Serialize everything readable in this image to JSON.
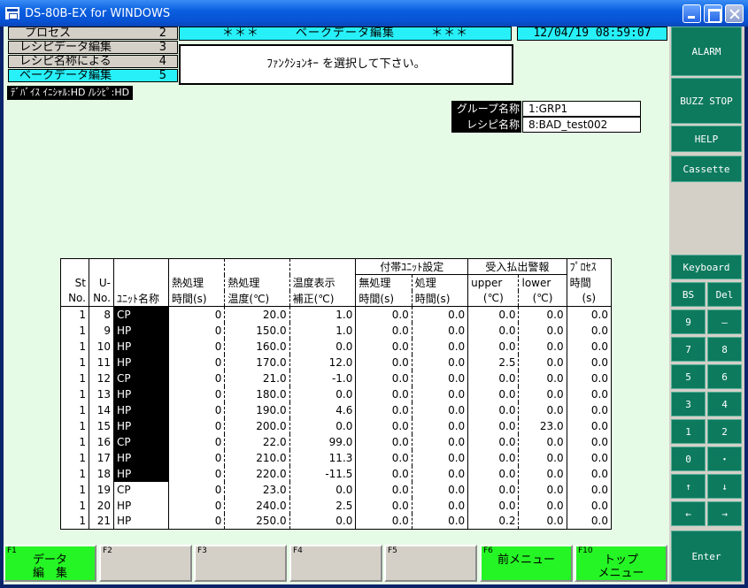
{
  "window": {
    "title": "DS-80B-EX for WINDOWS"
  },
  "menu": [
    {
      "label": "プロセス",
      "num": "2"
    },
    {
      "label": "レシピデータ編集",
      "num": "3"
    },
    {
      "label": "レシピ名称による",
      "num": "4"
    },
    {
      "label": "ベークデータ編集",
      "num": "5"
    }
  ],
  "header": {
    "left_marks": "＊＊＊",
    "title": "ベークデータ編集",
    "right_marks": "＊＊＊"
  },
  "datetime": "12/04/19 08:59:07",
  "message": "ﾌｧﾝｸｼｮﾝｷｰ を選択して下さい。",
  "device": "ﾃﾞﾊﾞｲｽ ｲﾆｼｬﾙ:HD /ﾚｼﾋﾟ:HD",
  "group": {
    "label": "グループ名称",
    "value": "1:GRP1"
  },
  "recipe": {
    "label": "レシピ名称",
    "value": "8:BAD_test002"
  },
  "side": {
    "alarm": "ALARM",
    "buzz": "BUZZ STOP",
    "help": "HELP",
    "cassette": "Cassette",
    "keyboard": "Keyboard",
    "bs": "BS",
    "del": "Del",
    "k9": "9",
    "kminus": "—",
    "k7": "7",
    "k8": "8",
    "k5": "5",
    "k6": "6",
    "k3": "3",
    "k4": "4",
    "k1": "1",
    "k2": "2",
    "k0": "0",
    "kdot": "・",
    "up": "↑",
    "down": "↓",
    "left": "←",
    "right": "→",
    "enter": "Enter"
  },
  "table": {
    "group_headers": {
      "unit_setting": "付帯ﾕﾆｯﾄ設定",
      "alarm": "受入払出警報",
      "process": "ﾌﾟﾛｾｽ"
    },
    "headers": {
      "st": [
        "St",
        "No."
      ],
      "u": [
        "U-",
        "No."
      ],
      "unit": "ﾕﾆｯﾄ名称",
      "heat_time": [
        "熱処理",
        "時間(s)"
      ],
      "heat_temp": [
        "熱処理",
        "温度(℃)"
      ],
      "temp_corr": [
        "温度表示",
        "補正(℃)"
      ],
      "no_proc": [
        "無処理",
        "時間(s)"
      ],
      "proc": [
        "処理",
        "時間(s)"
      ],
      "upper": [
        "upper",
        "(℃)"
      ],
      "lower": [
        "lower",
        "(℃)"
      ],
      "proc_time": [
        "時間",
        "(s)"
      ]
    },
    "rows": [
      [
        "1",
        "8",
        "CP",
        "0",
        "20.0",
        "1.0",
        "0.0",
        "0.0",
        "0.0",
        "0.0",
        "0.0"
      ],
      [
        "1",
        "9",
        "HP",
        "0",
        "150.0",
        "1.0",
        "0.0",
        "0.0",
        "0.0",
        "0.0",
        "0.0"
      ],
      [
        "1",
        "10",
        "HP",
        "0",
        "160.0",
        "0.0",
        "0.0",
        "0.0",
        "0.0",
        "0.0",
        "0.0"
      ],
      [
        "1",
        "11",
        "HP",
        "0",
        "170.0",
        "12.0",
        "0.0",
        "0.0",
        "2.5",
        "0.0",
        "0.0"
      ],
      [
        "1",
        "12",
        "CP",
        "0",
        "21.0",
        "-1.0",
        "0.0",
        "0.0",
        "0.0",
        "0.0",
        "0.0"
      ],
      [
        "1",
        "13",
        "HP",
        "0",
        "180.0",
        "0.0",
        "0.0",
        "0.0",
        "0.0",
        "0.0",
        "0.0"
      ],
      [
        "1",
        "14",
        "HP",
        "0",
        "190.0",
        "4.6",
        "0.0",
        "0.0",
        "0.0",
        "0.0",
        "0.0"
      ],
      [
        "1",
        "15",
        "HP",
        "0",
        "200.0",
        "0.0",
        "0.0",
        "0.0",
        "0.0",
        "23.0",
        "0.0"
      ],
      [
        "1",
        "16",
        "CP",
        "0",
        "22.0",
        "99.0",
        "0.0",
        "0.0",
        "0.0",
        "0.0",
        "0.0"
      ],
      [
        "1",
        "17",
        "HP",
        "0",
        "210.0",
        "11.3",
        "0.0",
        "0.0",
        "0.0",
        "0.0",
        "0.0"
      ],
      [
        "1",
        "18",
        "HP",
        "0",
        "220.0",
        "-11.5",
        "0.0",
        "0.0",
        "0.0",
        "0.0",
        "0.0"
      ],
      [
        "1",
        "19",
        "CP",
        "0",
        "23.0",
        "0.0",
        "0.0",
        "0.0",
        "0.0",
        "0.0",
        "0.0"
      ],
      [
        "1",
        "20",
        "HP",
        "0",
        "240.0",
        "2.5",
        "0.0",
        "0.0",
        "0.0",
        "0.0",
        "0.0"
      ],
      [
        "1",
        "21",
        "HP",
        "0",
        "250.0",
        "0.0",
        "0.0",
        "0.0",
        "0.2",
        "0.0",
        "0.0"
      ]
    ],
    "dark_unit_rows": 11
  },
  "fkeys": [
    {
      "num": "F1",
      "label": "データ\n編　集",
      "green": true
    },
    {
      "num": "F2",
      "label": "",
      "green": false
    },
    {
      "num": "F3",
      "label": "",
      "green": false
    },
    {
      "num": "F4",
      "label": "",
      "green": false
    },
    {
      "num": "F5",
      "label": "",
      "green": false
    },
    {
      "num": "F6",
      "label": "前メニュー",
      "green": true
    },
    {
      "num": "F10",
      "label": "トップ\nメニュー",
      "green": true
    }
  ]
}
